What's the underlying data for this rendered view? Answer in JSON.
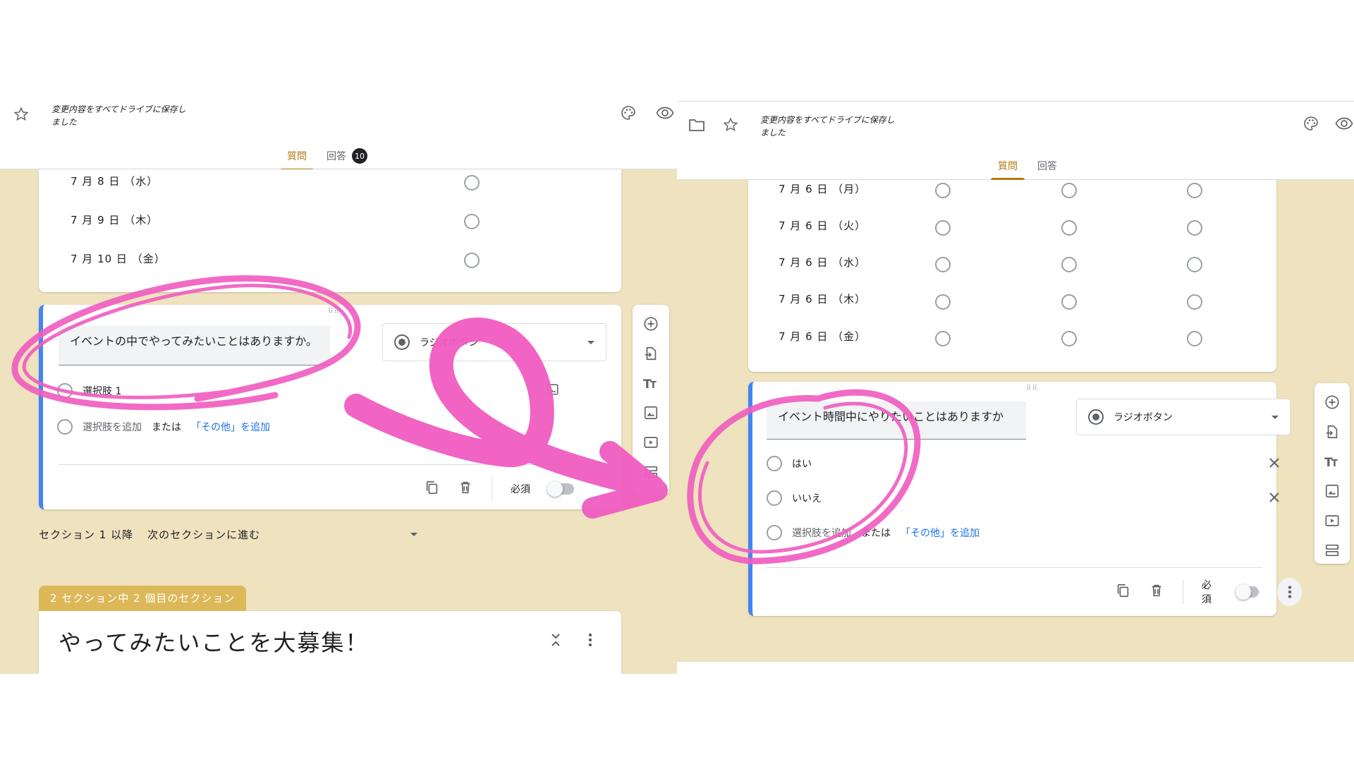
{
  "left": {
    "saved_status": "変更内容をすべてドライブに保存しました",
    "tabs": {
      "questions": "質問",
      "responses": "回答",
      "responses_count": "10"
    },
    "prev_question": {
      "rows": [
        "7 月 8 日 （水）",
        "7 月 9 日 （木）",
        "7 月 10 日 （金）"
      ]
    },
    "question": {
      "title": "イベントの中でやってみたいことはありますか。",
      "type": "ラジオボタン",
      "option1": "選択肢 1",
      "add_option": "選択肢を追加",
      "or": "または",
      "add_other": "「その他」を追加",
      "required": "必須"
    },
    "after_section": {
      "label": "セクション 1 以降",
      "value": "次のセクションに進む"
    },
    "section_tag": "2 セクション中 2 個目のセクション",
    "section_title": "やってみたいことを大募集！"
  },
  "right": {
    "saved_status": "変更内容をすべてドライブに保存しました",
    "tabs": {
      "questions": "質問",
      "responses": "回答"
    },
    "grid_rows": [
      "7 月 6 日 （月）",
      "7 月 6 日 （火）",
      "7 月 6 日 （水）",
      "7 月 6 日 （木）",
      "7 月 6 日 （金）"
    ],
    "question": {
      "title": "イベント時間中にやりたいことはありますか",
      "type": "ラジオボタン",
      "options": [
        "はい",
        "いいえ"
      ],
      "add_option": "選択肢を追加",
      "or": "または",
      "add_other": "「その他」を追加",
      "required": "必須"
    }
  },
  "colors": {
    "accent": "#b07c10",
    "background": "#efe2bf",
    "active_border": "#4285f4",
    "annotation": "#f05cc0",
    "link": "#1a73e8",
    "section_tag": "#ddb859"
  }
}
